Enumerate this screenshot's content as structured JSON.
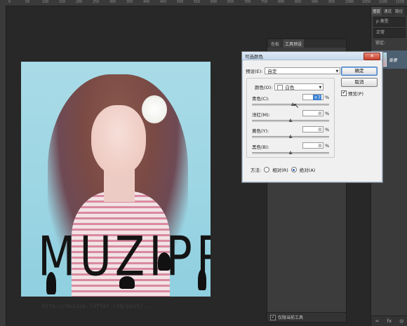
{
  "ruler": {
    "ticks": [
      "0",
      "50",
      "100",
      "150",
      "200",
      "250",
      "300",
      "350",
      "400",
      "450",
      "500",
      "550",
      "600",
      "650",
      "700",
      "750",
      "800",
      "850",
      "900",
      "950",
      "1000",
      "1050",
      "1100",
      "1150"
    ]
  },
  "canvas": {
    "wordmark": "MUZIPP",
    "watermark": "http://muzipp.lofter.com/post/..."
  },
  "mid_panel": {
    "tabs": [
      "色板",
      "工具预设"
    ],
    "active_tab": 1,
    "footer_checkbox": "✔",
    "footer_label": "仅限当前工具"
  },
  "far_panel": {
    "tabs": [
      "图层",
      "通道",
      "路径"
    ],
    "active_tab": 0,
    "filter_label": "ρ 类型",
    "blend_mode": "正常",
    "lock_label": "锁定:",
    "layer_name": "背景",
    "bottom_icons": [
      "∞",
      "fx",
      "◎"
    ]
  },
  "dialog": {
    "title": "可选颜色",
    "close_glyph": "✕",
    "preset_label": "预设(E):",
    "preset_value": "自定",
    "colors_label": "颜色(O):",
    "colors_value": "白色",
    "sliders": [
      {
        "label": "青色(C):",
        "value": "+7",
        "fraction": 0.53
      },
      {
        "label": "洋红(M):",
        "value": "0",
        "fraction": 0.5
      },
      {
        "label": "黄色(Y):",
        "value": "0",
        "fraction": 0.5
      },
      {
        "label": "黑色(B):",
        "value": "0",
        "fraction": 0.5
      }
    ],
    "percent": "%",
    "ok_label": "确定",
    "cancel_label": "取消",
    "preview_check": "✔",
    "preview_label": "预览(P)",
    "method_label": "方法:",
    "relative_label": "相对(R)",
    "absolute_label": "绝对(A)",
    "method_selected": "absolute"
  },
  "colors": {
    "dialog_accent": "#3b82d4",
    "layer_selected": "#4d6072",
    "close_red": "#c8412c"
  }
}
